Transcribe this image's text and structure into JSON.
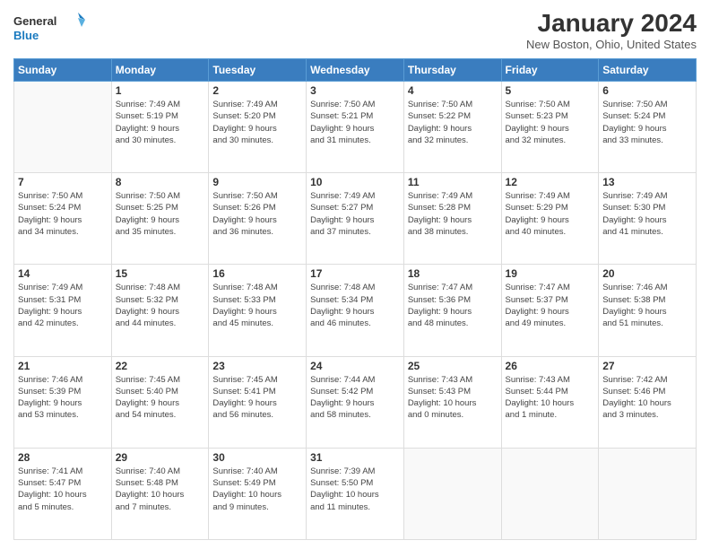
{
  "logo": {
    "line1": "General",
    "line2": "Blue"
  },
  "title": "January 2024",
  "location": "New Boston, Ohio, United States",
  "days_header": [
    "Sunday",
    "Monday",
    "Tuesday",
    "Wednesday",
    "Thursday",
    "Friday",
    "Saturday"
  ],
  "weeks": [
    [
      {
        "day": "",
        "info": ""
      },
      {
        "day": "1",
        "info": "Sunrise: 7:49 AM\nSunset: 5:19 PM\nDaylight: 9 hours\nand 30 minutes."
      },
      {
        "day": "2",
        "info": "Sunrise: 7:49 AM\nSunset: 5:20 PM\nDaylight: 9 hours\nand 30 minutes."
      },
      {
        "day": "3",
        "info": "Sunrise: 7:50 AM\nSunset: 5:21 PM\nDaylight: 9 hours\nand 31 minutes."
      },
      {
        "day": "4",
        "info": "Sunrise: 7:50 AM\nSunset: 5:22 PM\nDaylight: 9 hours\nand 32 minutes."
      },
      {
        "day": "5",
        "info": "Sunrise: 7:50 AM\nSunset: 5:23 PM\nDaylight: 9 hours\nand 32 minutes."
      },
      {
        "day": "6",
        "info": "Sunrise: 7:50 AM\nSunset: 5:24 PM\nDaylight: 9 hours\nand 33 minutes."
      }
    ],
    [
      {
        "day": "7",
        "info": "Sunrise: 7:50 AM\nSunset: 5:24 PM\nDaylight: 9 hours\nand 34 minutes."
      },
      {
        "day": "8",
        "info": "Sunrise: 7:50 AM\nSunset: 5:25 PM\nDaylight: 9 hours\nand 35 minutes."
      },
      {
        "day": "9",
        "info": "Sunrise: 7:50 AM\nSunset: 5:26 PM\nDaylight: 9 hours\nand 36 minutes."
      },
      {
        "day": "10",
        "info": "Sunrise: 7:49 AM\nSunset: 5:27 PM\nDaylight: 9 hours\nand 37 minutes."
      },
      {
        "day": "11",
        "info": "Sunrise: 7:49 AM\nSunset: 5:28 PM\nDaylight: 9 hours\nand 38 minutes."
      },
      {
        "day": "12",
        "info": "Sunrise: 7:49 AM\nSunset: 5:29 PM\nDaylight: 9 hours\nand 40 minutes."
      },
      {
        "day": "13",
        "info": "Sunrise: 7:49 AM\nSunset: 5:30 PM\nDaylight: 9 hours\nand 41 minutes."
      }
    ],
    [
      {
        "day": "14",
        "info": "Sunrise: 7:49 AM\nSunset: 5:31 PM\nDaylight: 9 hours\nand 42 minutes."
      },
      {
        "day": "15",
        "info": "Sunrise: 7:48 AM\nSunset: 5:32 PM\nDaylight: 9 hours\nand 44 minutes."
      },
      {
        "day": "16",
        "info": "Sunrise: 7:48 AM\nSunset: 5:33 PM\nDaylight: 9 hours\nand 45 minutes."
      },
      {
        "day": "17",
        "info": "Sunrise: 7:48 AM\nSunset: 5:34 PM\nDaylight: 9 hours\nand 46 minutes."
      },
      {
        "day": "18",
        "info": "Sunrise: 7:47 AM\nSunset: 5:36 PM\nDaylight: 9 hours\nand 48 minutes."
      },
      {
        "day": "19",
        "info": "Sunrise: 7:47 AM\nSunset: 5:37 PM\nDaylight: 9 hours\nand 49 minutes."
      },
      {
        "day": "20",
        "info": "Sunrise: 7:46 AM\nSunset: 5:38 PM\nDaylight: 9 hours\nand 51 minutes."
      }
    ],
    [
      {
        "day": "21",
        "info": "Sunrise: 7:46 AM\nSunset: 5:39 PM\nDaylight: 9 hours\nand 53 minutes."
      },
      {
        "day": "22",
        "info": "Sunrise: 7:45 AM\nSunset: 5:40 PM\nDaylight: 9 hours\nand 54 minutes."
      },
      {
        "day": "23",
        "info": "Sunrise: 7:45 AM\nSunset: 5:41 PM\nDaylight: 9 hours\nand 56 minutes."
      },
      {
        "day": "24",
        "info": "Sunrise: 7:44 AM\nSunset: 5:42 PM\nDaylight: 9 hours\nand 58 minutes."
      },
      {
        "day": "25",
        "info": "Sunrise: 7:43 AM\nSunset: 5:43 PM\nDaylight: 10 hours\nand 0 minutes."
      },
      {
        "day": "26",
        "info": "Sunrise: 7:43 AM\nSunset: 5:44 PM\nDaylight: 10 hours\nand 1 minute."
      },
      {
        "day": "27",
        "info": "Sunrise: 7:42 AM\nSunset: 5:46 PM\nDaylight: 10 hours\nand 3 minutes."
      }
    ],
    [
      {
        "day": "28",
        "info": "Sunrise: 7:41 AM\nSunset: 5:47 PM\nDaylight: 10 hours\nand 5 minutes."
      },
      {
        "day": "29",
        "info": "Sunrise: 7:40 AM\nSunset: 5:48 PM\nDaylight: 10 hours\nand 7 minutes."
      },
      {
        "day": "30",
        "info": "Sunrise: 7:40 AM\nSunset: 5:49 PM\nDaylight: 10 hours\nand 9 minutes."
      },
      {
        "day": "31",
        "info": "Sunrise: 7:39 AM\nSunset: 5:50 PM\nDaylight: 10 hours\nand 11 minutes."
      },
      {
        "day": "",
        "info": ""
      },
      {
        "day": "",
        "info": ""
      },
      {
        "day": "",
        "info": ""
      }
    ]
  ]
}
